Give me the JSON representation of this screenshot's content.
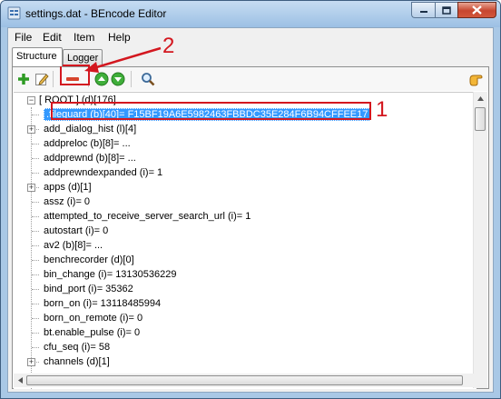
{
  "window": {
    "title": "settings.dat - BEncode Editor"
  },
  "menu": {
    "file": "File",
    "edit": "Edit",
    "item": "Item",
    "help": "Help"
  },
  "tabs": {
    "structure": "Structure",
    "logger": "Logger"
  },
  "tree": {
    "root": "[ ROOT ] (d)[176]",
    "rows": [
      ".fileguard (b)[40]= F15BF19A6E5982463FBBDC35E284F6B94CFFEE17",
      "add_dialog_hist (l)[4]",
      "addpreloc (b)[8]= ...",
      "addprewnd (b)[8]= ...",
      "addprewndexpanded (i)= 1",
      "apps (d)[1]",
      "assz (i)= 0",
      "attempted_to_receive_server_search_url (i)= 1",
      "autostart (i)= 0",
      "av2 (b)[8]= ...",
      "benchrecorder (d)[0]",
      "bin_change (i)= 13130536229",
      "bind_port (i)= 35362",
      "born_on (i)= 13118485994",
      "born_on_remote (i)= 0",
      "bt.enable_pulse (i)= 0",
      "cfu_seq (i)= 58",
      "channels (d)[1]"
    ]
  },
  "annotations": {
    "label1": "1",
    "label2": "2"
  }
}
